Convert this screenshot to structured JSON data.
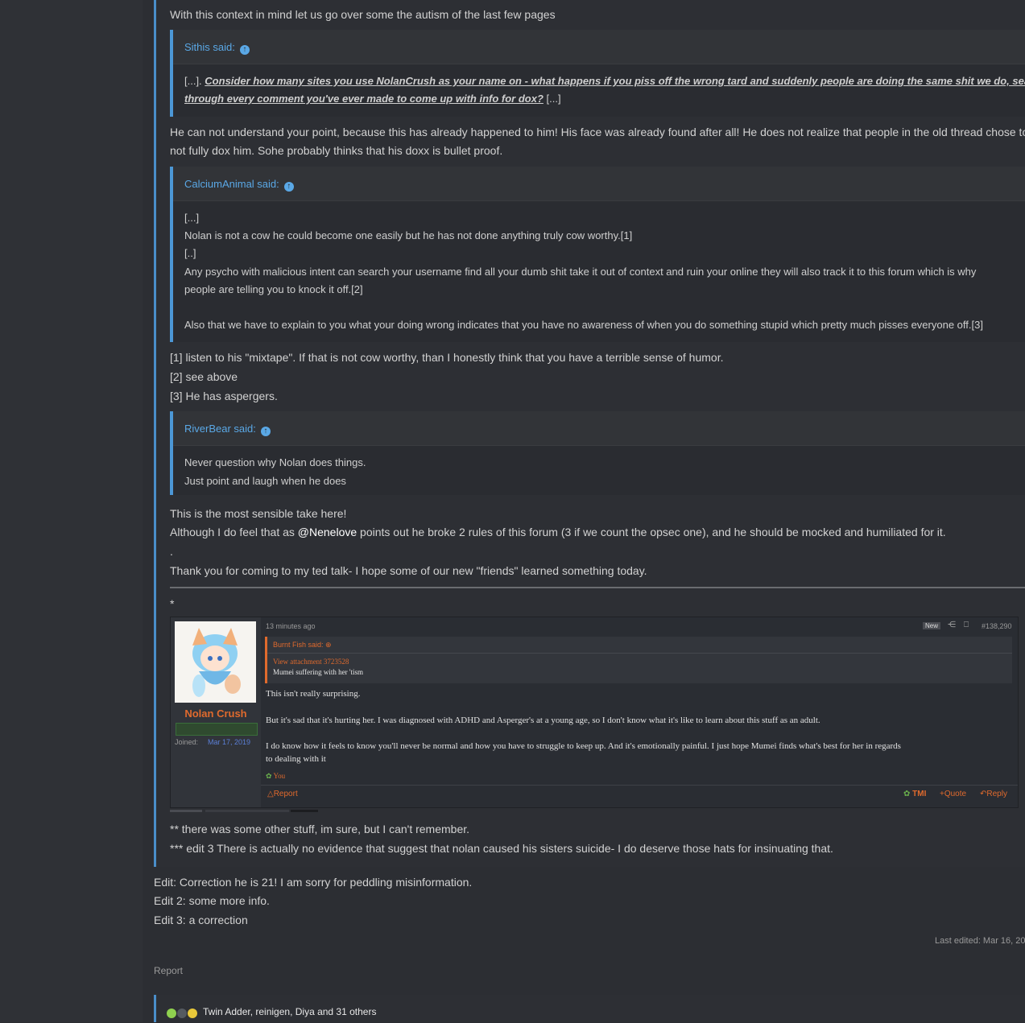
{
  "post": {
    "intro": "With this context in mind let us go over some the autism of the last few pages",
    "quote1": {
      "author": "Sithis said:",
      "line1_pre": "[...]. ",
      "line1_emph": "Consider how many sites you use NolanCrush as your name on - what happens if you piss off the wrong tard and suddenly people are doing the same shit we do, searching",
      "line2_emph": "through every comment you've ever made to come up with info for dox?",
      "line2_post": " [...]"
    },
    "para1_l1": "He can not understand your point, because this has already happened to him! His face was already found after all! He does not realize that people in the old thread chose to",
    "para1_l2": "not fully dox him. Sohe probably thinks that his doxx is bullet proof.",
    "quote2": {
      "author": "CalciumAnimal said:",
      "lines": [
        "[...]",
        "Nolan is not a cow he could become one easily but he has not done anything truly cow worthy.[1]",
        "[..]",
        "Any psycho with malicious intent can search your username find all your dumb shit take it out of context and ruin your online they will also track it to this forum which is why",
        "people are telling you to knock it off.[2]",
        "Also that we have to explain to you what your doing wrong indicates that you have no awareness of when you do something stupid which pretty much pisses everyone off.[3]"
      ]
    },
    "notes": [
      "[1] listen to his \"mixtape\". If that is not cow worthy, than I honestly think that you have a terrible sense of humor.",
      "[2] see above",
      "[3] He has aspergers."
    ],
    "quote3": {
      "author": "RiverBear said:",
      "lines": [
        "Never question why Nolan does things.",
        "Just point and laugh when he does"
      ]
    },
    "sensible": "This is the most sensible take here!",
    "although_pre": "Although I do feel that as ",
    "mention": "@Nenelove",
    "although_post": " points out he broke 2 rules of this forum (3 if we count the opsec one), and he should be mocked and humiliated for it.",
    "dot": ".",
    "thanks": "Thank you for coming to my ted talk- I hope some of our new \"friends\" learned something today.",
    "star": "*",
    "footnote1": "** there was some other stuff, im sure, but I can't remember.",
    "footnote2": "*** edit 3 There is actually no evidence that suggest that nolan caused his sisters suicide- I do deserve those hats for insinuating that."
  },
  "embedded": {
    "username": "Nolan Crush",
    "joined_label": "Joined:",
    "joined_date": "Mar 17, 2019",
    "time": "13 minutes ago",
    "new_badge": "New",
    "post_number": "#138,290",
    "quote_author": "Burnt Fish said:",
    "attachment": "View attachment 3723528",
    "quote_text": "Mumei suffering with her 'tism",
    "p1": "This isn't really surprising.",
    "p2": "But it's sad that it's hurting her. I was diagnosed with ADHD and Asperger's at a young age, so I don't know what it's like to learn about this stuff as an adult.",
    "p3a": "I do know how it feels to know you'll never be normal and how you have to struggle to keep up. And it's emotionally painful. I just hope Mumei finds what's best for her in regards",
    "p3b": "to dealing with it",
    "reaction": "You",
    "report": "Report",
    "tmi": "TMI",
    "quote": "+Quote",
    "reply": "Reply"
  },
  "edits": [
    "Edit: Correction he is 21! I am sorry for peddling misinformation.",
    "Edit 2: some more info.",
    "Edit 3: a correction"
  ],
  "last_edited": "Last edited: Mar 16, 20",
  "report": "Report",
  "reactions": "Twin Adder, reinigen, Diya and 31 others",
  "colors": {
    "link": "#5aa8e6",
    "accent_orange": "#e06a2d",
    "background": "#2b2d31"
  }
}
